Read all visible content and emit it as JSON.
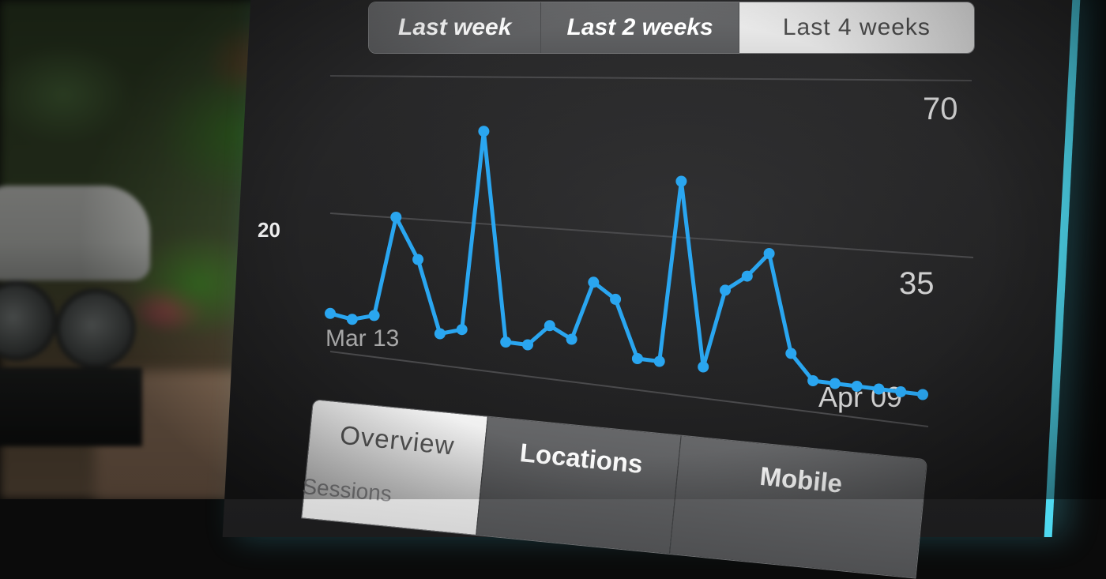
{
  "range_tabs": [
    {
      "label": "Last week",
      "selected": false
    },
    {
      "label": "Last 2 weeks",
      "selected": false
    },
    {
      "label": "Last 4 weeks",
      "selected": true
    }
  ],
  "bottom_tabs": [
    {
      "label": "Overview",
      "selected": true
    },
    {
      "label": "Locations",
      "selected": false
    },
    {
      "label": "Mobile",
      "selected": false
    }
  ],
  "sessions_label": "Sessions",
  "edge_label": "20",
  "colors": {
    "line": "#2aa6f0",
    "accent_edge": "#4fd9f0"
  },
  "chart_data": {
    "type": "line",
    "title": "",
    "x_start_label": "Mar 13",
    "x_end_label": "Apr 09",
    "yticks": [
      35,
      70
    ],
    "ylim": [
      0,
      75
    ],
    "grid": true,
    "series": [
      {
        "values": [
          2,
          1,
          3,
          33,
          21,
          0,
          2,
          59,
          0,
          0,
          6,
          3,
          19,
          15,
          0,
          0,
          47,
          0,
          20,
          24,
          30,
          6,
          0,
          0,
          0,
          0,
          0,
          0
        ]
      }
    ]
  }
}
